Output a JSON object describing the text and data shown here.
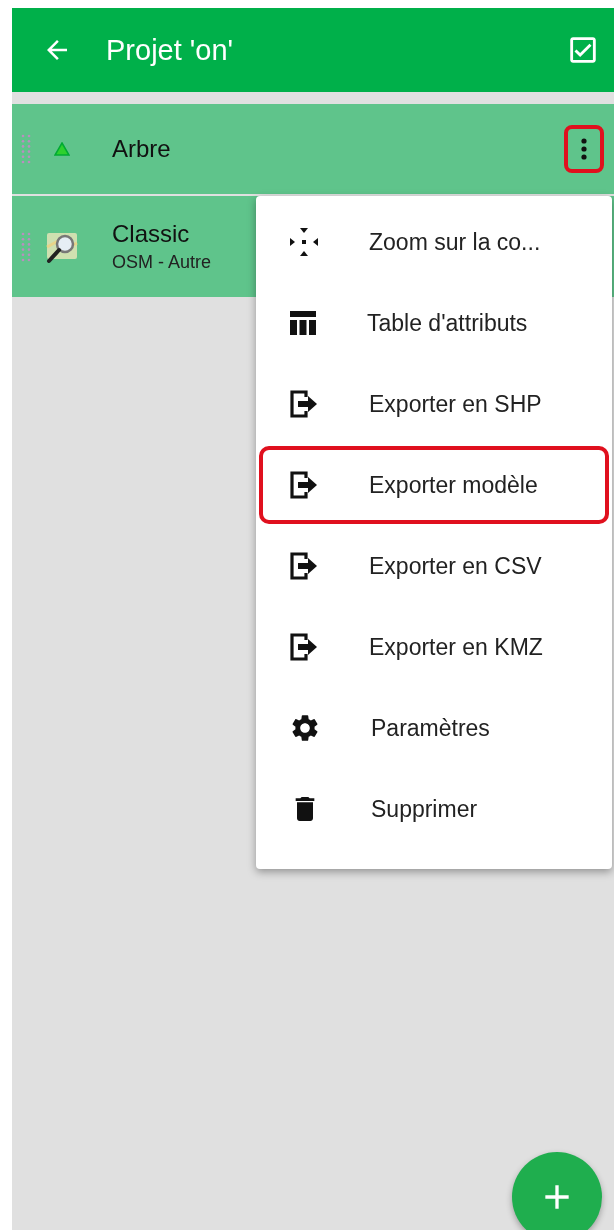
{
  "app_bar": {
    "title": "Projet 'on'"
  },
  "layers": [
    {
      "kind": "vector",
      "name": "Arbre",
      "menu_highlighted": true
    },
    {
      "kind": "basemap",
      "name": "Classic",
      "subtitle": "OSM - Autre"
    }
  ],
  "menu": [
    {
      "kind": "zoom",
      "label": "Zoom sur la co...",
      "highlighted": false
    },
    {
      "kind": "table",
      "label": "Table d'attributs",
      "highlighted": false
    },
    {
      "kind": "export",
      "label": "Exporter en SHP",
      "highlighted": false
    },
    {
      "kind": "export",
      "label": "Exporter modèle",
      "highlighted": true
    },
    {
      "kind": "export",
      "label": "Exporter en CSV",
      "highlighted": false
    },
    {
      "kind": "export",
      "label": "Exporter en KMZ",
      "highlighted": false
    },
    {
      "kind": "settings",
      "label": "Paramètres",
      "highlighted": false
    },
    {
      "kind": "delete",
      "label": "Supprimer",
      "highlighted": false
    }
  ]
}
